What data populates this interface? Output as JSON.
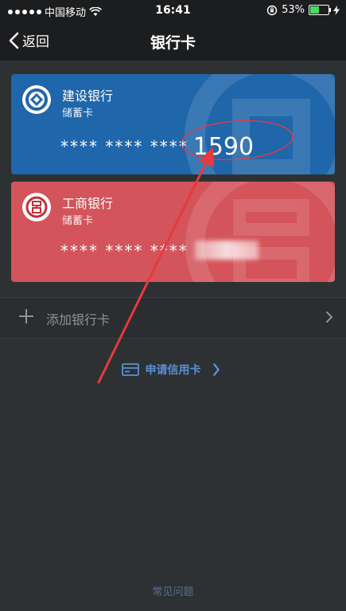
{
  "status_bar": {
    "carrier": "中国移动",
    "time": "16:41",
    "battery_percent": "53%",
    "battery_level": 0.53
  },
  "nav": {
    "back_label": "返回",
    "title": "银行卡"
  },
  "cards": [
    {
      "bank_name": "建设银行",
      "card_type": "储蓄卡",
      "masked_number": "**** **** ****",
      "last_digits": "1590",
      "color": "#1f66ab"
    },
    {
      "bank_name": "工商银行",
      "card_type": "储蓄卡",
      "masked_number": "**** **** ****",
      "last_digits": "",
      "color": "#d3545a"
    }
  ],
  "add_card": {
    "label": "添加银行卡"
  },
  "apply_credit": {
    "label": "申请信用卡"
  },
  "faq": {
    "label": "常见问题"
  },
  "colors": {
    "background": "#2e3133",
    "bar": "#1c1d1f",
    "link": "#5b8fd6",
    "annotation": "#e8393e"
  }
}
